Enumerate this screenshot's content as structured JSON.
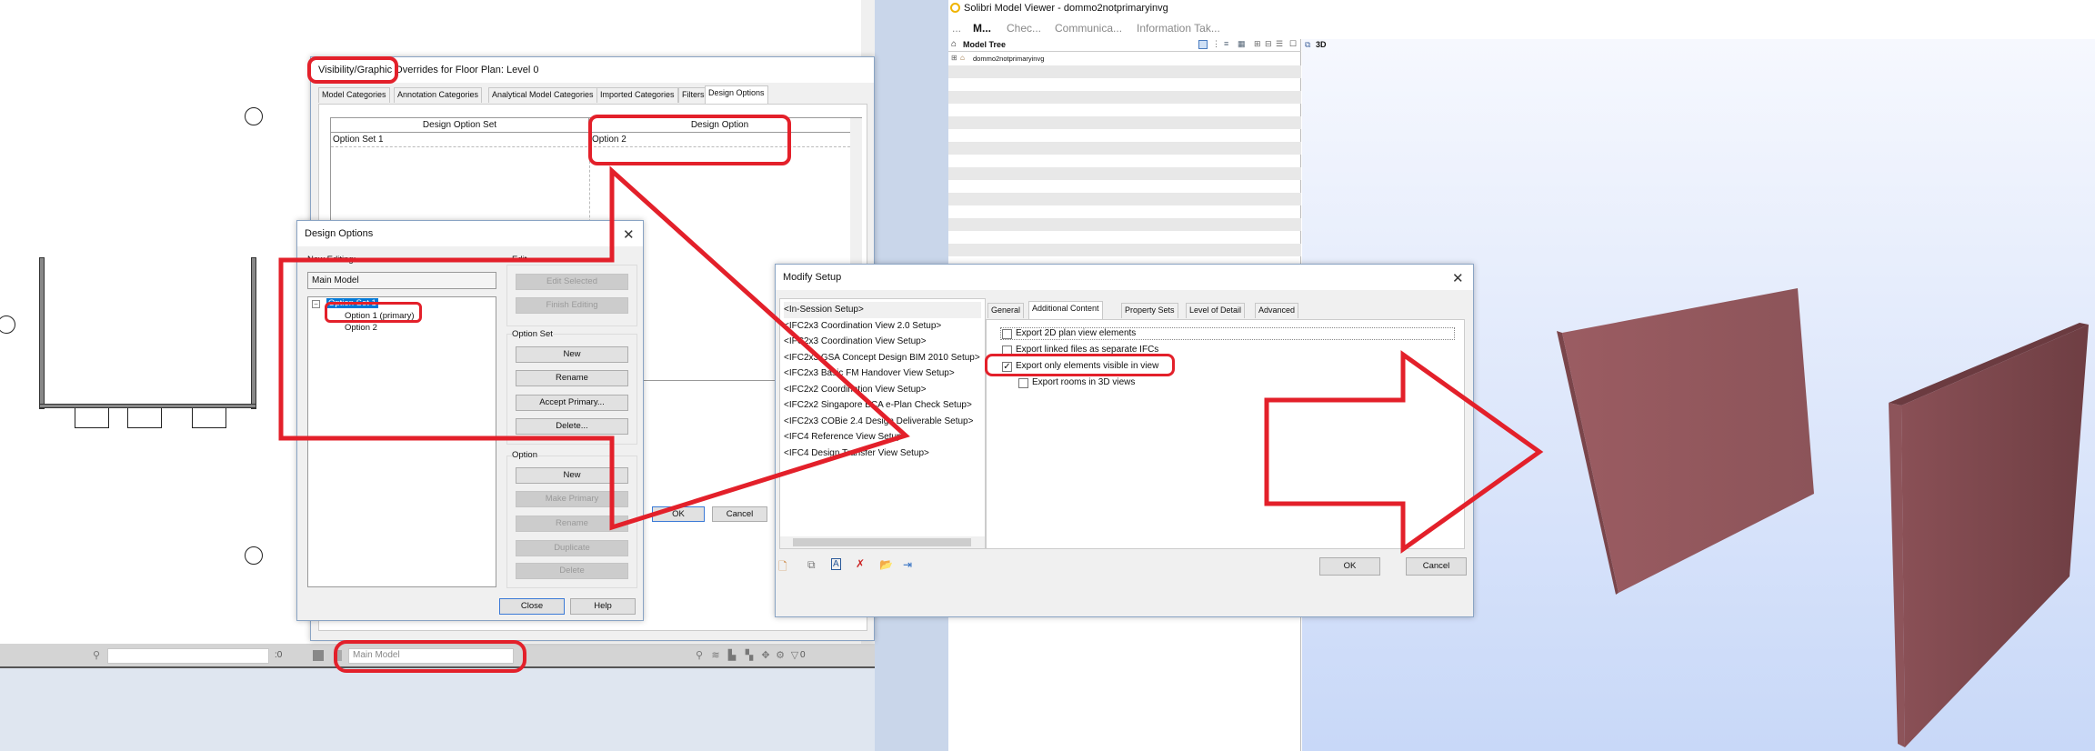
{
  "revit": {
    "visibility_dialog": {
      "title": "Visibility/Graphic Overrides for Floor Plan: Level 0",
      "tabs": [
        "Model Categories",
        "Annotation Categories",
        "Analytical Model Categories",
        "Imported Categories",
        "Filters",
        "Design Options"
      ],
      "active_tab": "Design Options",
      "columns": [
        "Design Option Set",
        "Design Option"
      ],
      "rows": [
        {
          "set": "Option Set 1",
          "option": "Option 2"
        }
      ],
      "ok_label": "OK",
      "cancel_label": "Cancel"
    },
    "design_options": {
      "title": "Design Options",
      "now_editing_label": "Now Editing:",
      "now_editing_value": "Main Model",
      "tree": {
        "set": "Option Set 1",
        "options": [
          "Option 1 (primary)",
          "Option 2"
        ]
      },
      "edit_group": {
        "label": "Edit",
        "buttons": [
          {
            "label": "Edit Selected",
            "enabled": false
          },
          {
            "label": "Finish Editing",
            "enabled": false
          }
        ]
      },
      "option_set_group": {
        "label": "Option Set",
        "buttons": [
          {
            "label": "New",
            "enabled": true
          },
          {
            "label": "Rename",
            "enabled": true
          },
          {
            "label": "Accept Primary...",
            "enabled": true
          },
          {
            "label": "Delete...",
            "enabled": true
          }
        ]
      },
      "option_group": {
        "label": "Option",
        "buttons": [
          {
            "label": "New",
            "enabled": true
          },
          {
            "label": "Make Primary",
            "enabled": false
          },
          {
            "label": "Rename",
            "enabled": false
          },
          {
            "label": "Duplicate",
            "enabled": false
          },
          {
            "label": "Delete",
            "enabled": false
          }
        ]
      },
      "close_label": "Close",
      "help_label": "Help"
    },
    "status_bar": {
      "selection_count": ":0",
      "design_option": "Main Model",
      "filter_count": "0"
    }
  },
  "modify_setup": {
    "title": "Modify Setup",
    "setups": [
      "<In-Session Setup>",
      "<IFC2x3 Coordination View 2.0 Setup>",
      "<IFC2x3 Coordination View Setup>",
      "<IFC2x3 GSA Concept Design BIM 2010 Setup>",
      "<IFC2x3 Basic FM Handover View Setup>",
      "<IFC2x2 Coordination View Setup>",
      "<IFC2x2 Singapore BCA e-Plan Check Setup>",
      "<IFC2x3 COBie 2.4 Design Deliverable Setup>",
      "<IFC4 Reference View Setup>",
      "<IFC4 Design Transfer View Setup>"
    ],
    "tabs": [
      "General",
      "Additional Content",
      "Property Sets",
      "Level of Detail",
      "Advanced"
    ],
    "active_tab": "Additional Content",
    "options": [
      {
        "label": "Export 2D plan view elements",
        "checked": false
      },
      {
        "label": "Export linked files as separate IFCs",
        "checked": false
      },
      {
        "label": "Export only elements visible in view",
        "checked": true
      },
      {
        "label": "Export rooms in 3D views",
        "checked": false
      }
    ],
    "ok_label": "OK",
    "cancel_label": "Cancel"
  },
  "solibri": {
    "title": "Solibri Model Viewer - dommo2notprimaryinvg",
    "menu": [
      "...",
      "M...",
      "Chec...",
      "Communica...",
      "Information Tak..."
    ],
    "model_tree": {
      "title": "Model Tree",
      "root": "dommo2notprimaryinvg"
    },
    "view_label": "3D",
    "wall_color": "#955a60"
  },
  "annotation_color": "#e3202a"
}
